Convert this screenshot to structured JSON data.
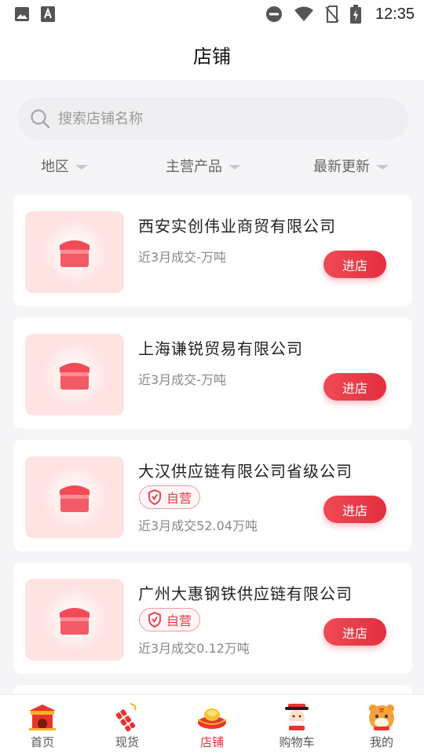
{
  "status_bar": {
    "time": "12:35",
    "left_icons": [
      "image-icon",
      "text-a-icon"
    ],
    "right_icons": [
      "do-not-disturb-icon",
      "wifi-icon",
      "no-sim-icon",
      "battery-charging-icon"
    ]
  },
  "header": {
    "title": "店铺"
  },
  "search": {
    "placeholder": "搜索店铺名称"
  },
  "filters": [
    {
      "label": "地区"
    },
    {
      "label": "主营产品"
    },
    {
      "label": "最新更新"
    }
  ],
  "shops": [
    {
      "name": "西安实创伟业商贸有限公司",
      "self_run": false,
      "stats": "近3月成交-万吨",
      "button": "进店"
    },
    {
      "name": "上海谦锐贸易有限公司",
      "self_run": false,
      "stats": "近3月成交-万吨",
      "button": "进店"
    },
    {
      "name": "大汉供应链有限公司省级公司",
      "self_run": true,
      "badge": "自营",
      "stats": "近3月成交52.04万吨",
      "button": "进店"
    },
    {
      "name": "广州大惠钢铁供应链有限公司",
      "self_run": true,
      "badge": "自营",
      "stats": "近3月成交0.12万吨",
      "button": "进店"
    }
  ],
  "tabbar": {
    "active": "店铺",
    "items": [
      {
        "label": "首页",
        "icon": "temple-gate-icon"
      },
      {
        "label": "现货",
        "icon": "firecracker-icon"
      },
      {
        "label": "店铺",
        "icon": "gold-ingot-icon"
      },
      {
        "label": "购物车",
        "icon": "fortune-god-icon"
      },
      {
        "label": "我的",
        "icon": "tiger-face-icon"
      }
    ]
  },
  "colors": {
    "accent": "#e32e3f",
    "thumb_bg": "#ffe3e2",
    "page_bg": "#f5f5f7"
  }
}
